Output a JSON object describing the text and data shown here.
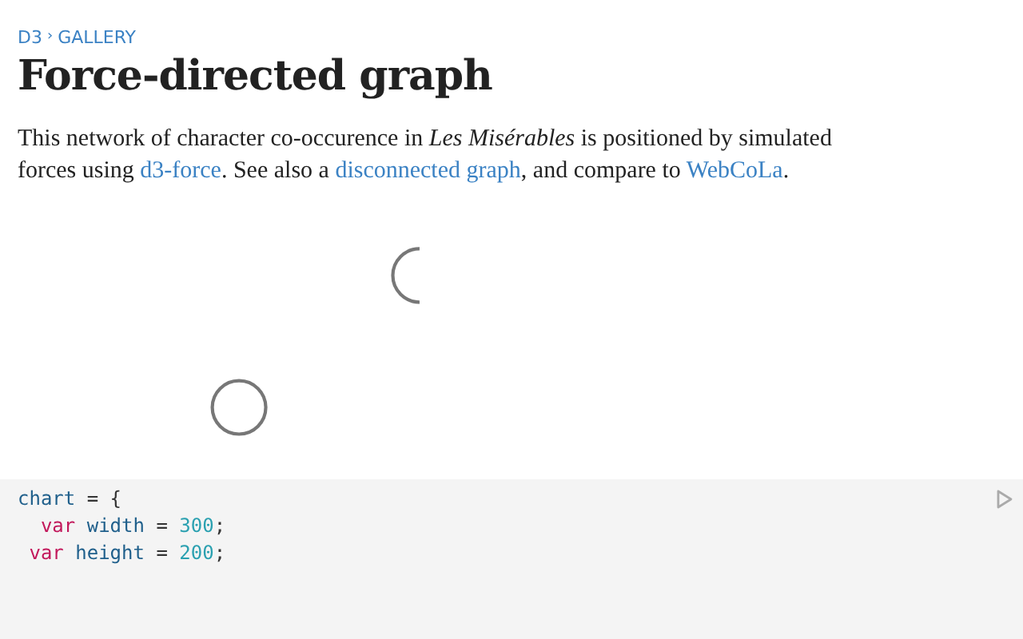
{
  "breadcrumb": {
    "items": [
      "D3",
      "GALLERY"
    ],
    "separator": "›"
  },
  "title": "Force-directed graph",
  "description": [
    {
      "kind": "text",
      "text": "This network of character co-occurence in *Les Misérables* is positioned by simulated forces using "
    },
    {
      "kind": "link",
      "text": "d3-force"
    },
    {
      "kind": "text",
      "text": ". See also a "
    },
    {
      "kind": "link",
      "text": "disconnected graph"
    },
    {
      "kind": "text",
      "text": ", and compare to "
    },
    {
      "kind": "link",
      "text": "WebCoLa"
    },
    {
      "kind": "text",
      "text": "."
    }
  ],
  "code": {
    "lines": [
      [
        {
          "kind": "name",
          "text": "chart"
        },
        {
          "kind": "plain",
          "text": " = {"
        }
      ],
      [
        {
          "kind": "keyword",
          "text": "  var"
        },
        {
          "kind": "name",
          "text": " width"
        },
        {
          "kind": "plain",
          "text": " = "
        },
        {
          "kind": "number",
          "text": "300"
        },
        {
          "kind": "plain",
          "text": ";"
        }
      ],
      [
        {
          "kind": "keyword",
          "text": " var"
        },
        {
          "kind": "name",
          "text": " height"
        },
        {
          "kind": "plain",
          "text": " = "
        },
        {
          "kind": "number",
          "text": "200"
        },
        {
          "kind": "plain",
          "text": ";"
        }
      ]
    ]
  }
}
